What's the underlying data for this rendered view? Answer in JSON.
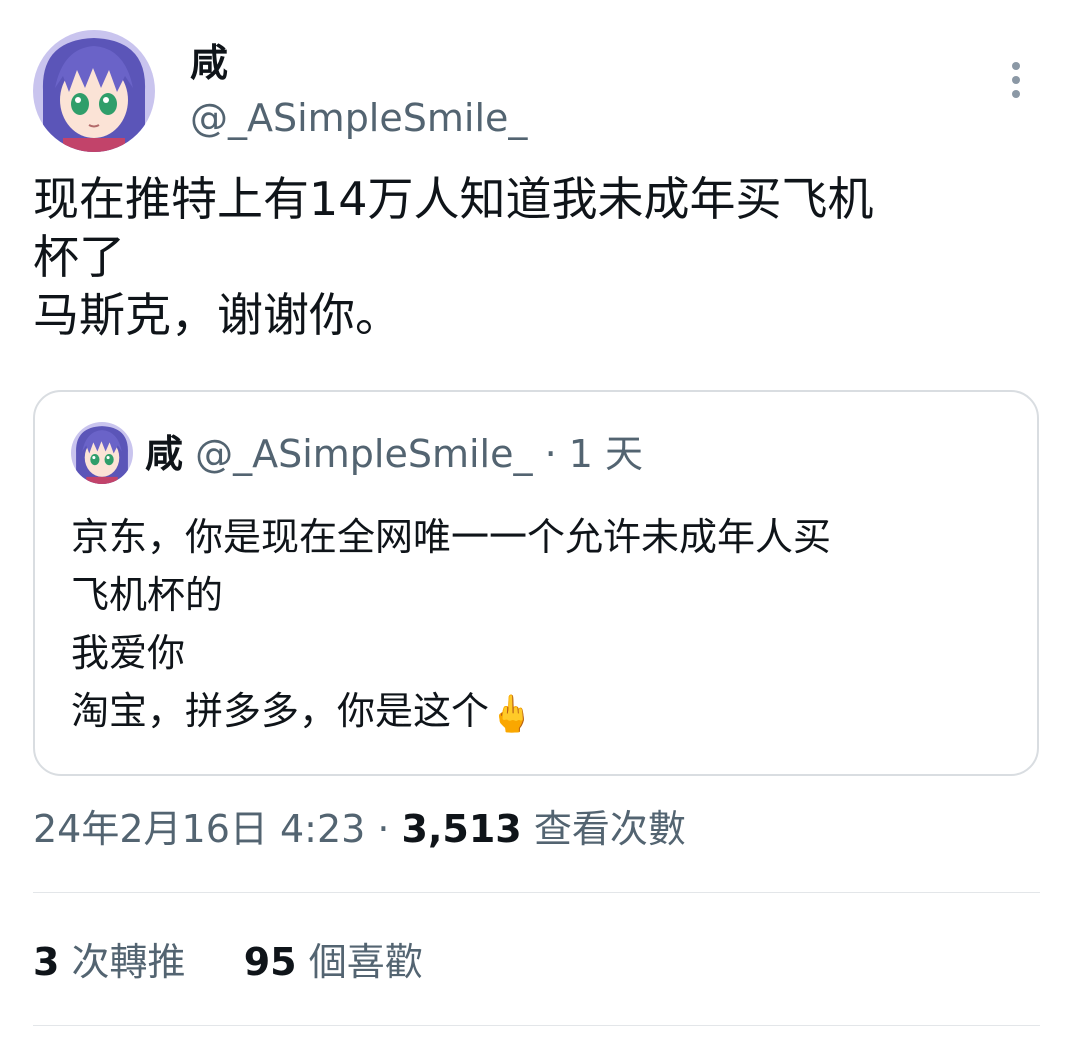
{
  "author": {
    "name": "咸",
    "handle": "@_ASimpleSmile_"
  },
  "tweet": {
    "lines": [
      "现在推特上有14万人知道我未成年买飞机",
      "杯了",
      "马斯克，谢谢你。"
    ]
  },
  "quote": {
    "name": "咸",
    "handle": "@_ASimpleSmile_",
    "separator": " · ",
    "time": "1 天",
    "lines": [
      "京东，你是现在全网唯一一个允许未成年人买",
      "飞机杯的",
      "我爱你",
      "淘宝，拼多多，你是这个"
    ],
    "emoji": "🖕"
  },
  "meta": {
    "timestamp": "24年2月16日 4:23",
    "separator": " · ",
    "views_count": "3,513",
    "views_label": " 查看次數"
  },
  "stats": {
    "retweets_count": "3",
    "retweets_label": " 次轉推",
    "likes_count": "95",
    "likes_label": " 個喜歡"
  },
  "icons": {
    "more": "more-vertical-icon",
    "avatar": "anime-avatar"
  },
  "colors": {
    "text": "#0f1419",
    "secondary": "#536471",
    "border": "#d9dde1",
    "divider": "#e3e6e9"
  }
}
